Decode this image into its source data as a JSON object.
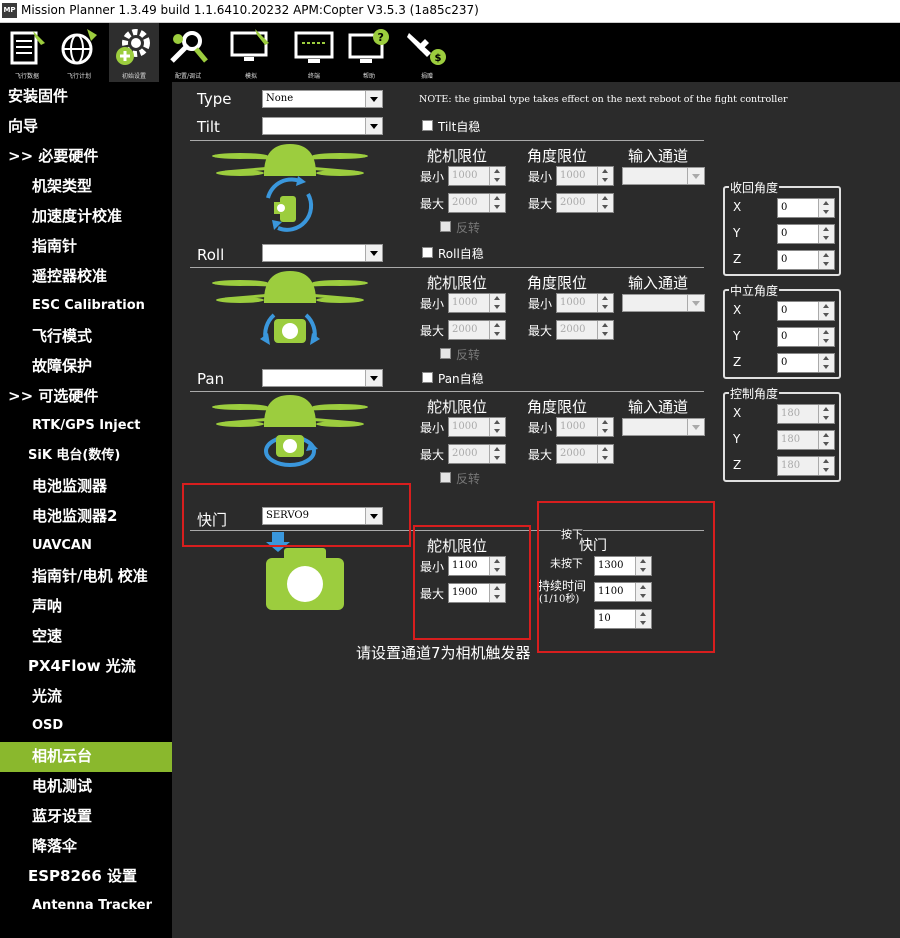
{
  "window": {
    "title": "Mission Planner 1.3.49 build 1.1.6410.20232 APM:Copter V3.5.3 (1a85c237)",
    "icon_text": "MP"
  },
  "toolbar": [
    {
      "label": "飞行数据",
      "icon": "flight-data-icon"
    },
    {
      "label": "飞行计划",
      "icon": "flight-plan-icon"
    },
    {
      "label": "初始设置",
      "icon": "initial-setup-icon"
    },
    {
      "label": "配置/调试",
      "icon": "config-tuning-icon"
    },
    {
      "label": "模拟",
      "icon": "simulation-icon"
    },
    {
      "label": "终端",
      "icon": "terminal-icon"
    },
    {
      "label": "帮助",
      "icon": "help-icon"
    },
    {
      "label": "捐赠",
      "icon": "donate-icon"
    }
  ],
  "sidebar": {
    "items": [
      {
        "label": "安装固件",
        "level": 0
      },
      {
        "label": "向导",
        "level": 0
      },
      {
        "label": ">> 必要硬件",
        "level": 0
      },
      {
        "label": "机架类型",
        "level": 1
      },
      {
        "label": "加速度计校准",
        "level": 1
      },
      {
        "label": "指南针",
        "level": 1
      },
      {
        "label": "遥控器校准",
        "level": 1
      },
      {
        "label": "ESC Calibration",
        "level": 1
      },
      {
        "label": "飞行模式",
        "level": 1
      },
      {
        "label": "故障保护",
        "level": 1
      },
      {
        "label": ">> 可选硬件",
        "level": 0
      },
      {
        "label": "RTK/GPS Inject",
        "level": 1
      },
      {
        "label": "SiK 电台(数传)",
        "level": 2
      },
      {
        "label": "电池监测器",
        "level": 1
      },
      {
        "label": "电池监测器2",
        "level": 1
      },
      {
        "label": "UAVCAN",
        "level": 1
      },
      {
        "label": "指南针/电机 校准",
        "level": 1
      },
      {
        "label": "声呐",
        "level": 1
      },
      {
        "label": "空速",
        "level": 1
      },
      {
        "label": "PX4Flow 光流",
        "level": 2
      },
      {
        "label": "光流",
        "level": 1
      },
      {
        "label": "OSD",
        "level": 1
      },
      {
        "label": "相机云台",
        "level": 1,
        "active": true
      },
      {
        "label": "电机测试",
        "level": 1
      },
      {
        "label": "蓝牙设置",
        "level": 1
      },
      {
        "label": "降落伞",
        "level": 1
      },
      {
        "label": "ESP8266 设置",
        "level": 2
      },
      {
        "label": "Antenna Tracker",
        "level": 1
      }
    ]
  },
  "gimbal": {
    "type_label": "Type",
    "type_value": "None",
    "note": "NOTE: the gimbal type takes effect on the next reboot of the fight controller",
    "labels": {
      "servo_limits": "舵机限位",
      "angle_limits": "角度限位",
      "input_channel": "输入通道",
      "min": "最小",
      "max": "最大",
      "reverse": "反转"
    },
    "tilt": {
      "label": "Tilt",
      "stab_label": "Tilt自稳",
      "servo_min": "1000",
      "servo_max": "2000",
      "angle_min": "1000",
      "angle_max": "2000"
    },
    "roll": {
      "label": "Roll",
      "stab_label": "Roll自稳",
      "servo_min": "1000",
      "servo_max": "2000",
      "angle_min": "1000",
      "angle_max": "2000"
    },
    "pan": {
      "label": "Pan",
      "stab_label": "Pan自稳",
      "servo_min": "1000",
      "servo_max": "2000",
      "angle_min": "1000",
      "angle_max": "2000"
    },
    "retract": {
      "title": "收回角度",
      "x": "0",
      "y": "0",
      "z": "0"
    },
    "neutral": {
      "title": "中立角度",
      "x": "0",
      "y": "0",
      "z": "0"
    },
    "control": {
      "title": "控制角度",
      "x": "180",
      "y": "180",
      "z": "180"
    },
    "axis": {
      "x": "X",
      "y": "Y",
      "z": "Z"
    }
  },
  "shutter": {
    "label": "快门",
    "channel": "SERVO9",
    "servo_title": "舵机限位",
    "min": "1100",
    "max": "1900",
    "right_title_small": "按下",
    "right_title": "快门",
    "not_pressed_label": "未按下",
    "pressed_value": "1300",
    "not_pressed_value": "1100",
    "duration_label": "持续时间",
    "duration_unit": "(1/10秒)",
    "duration_value": "10",
    "hint": "请设置通道7为相机触发器"
  },
  "colors": {
    "accent": "#8ab82d",
    "drone_green": "#9ccd3e",
    "arrow_blue": "#3a97dc",
    "highlight_red": "#d81e1e"
  }
}
